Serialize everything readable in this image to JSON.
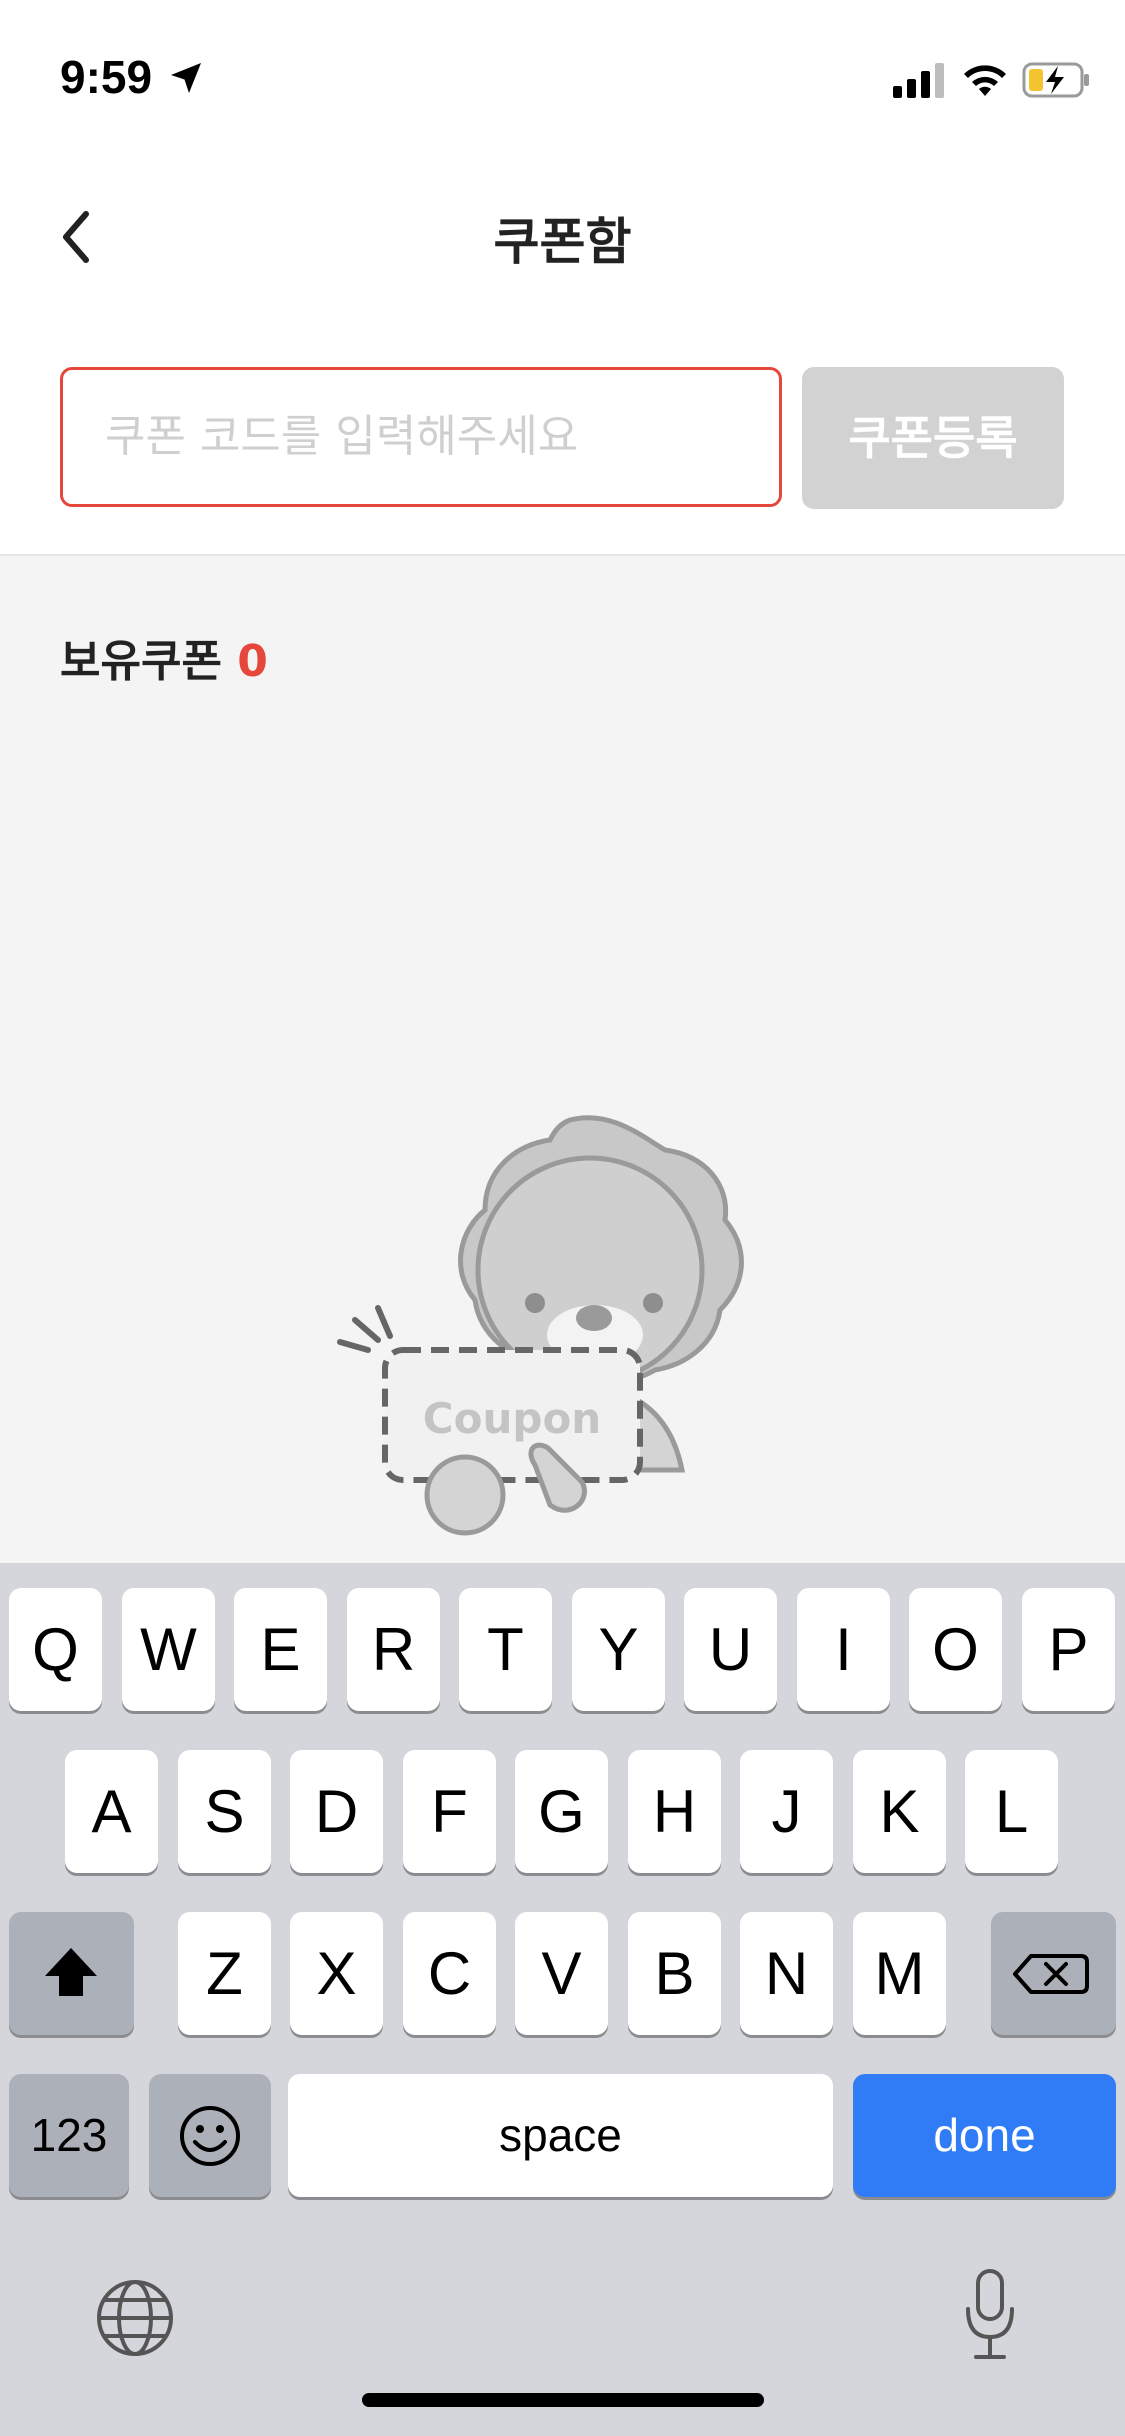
{
  "status_bar": {
    "time": "9:59"
  },
  "header": {
    "title": "쿠폰함"
  },
  "coupon_form": {
    "placeholder": "쿠폰 코드를 입력해주세요",
    "register_label": "쿠폰등록"
  },
  "owned": {
    "label": "보유쿠폰",
    "count": "0"
  },
  "illustration": {
    "coupon_text": "Coupon"
  },
  "keyboard": {
    "row1": [
      "Q",
      "W",
      "E",
      "R",
      "T",
      "Y",
      "U",
      "I",
      "O",
      "P"
    ],
    "row2": [
      "A",
      "S",
      "D",
      "F",
      "G",
      "H",
      "J",
      "K",
      "L"
    ],
    "row3": [
      "Z",
      "X",
      "C",
      "V",
      "B",
      "N",
      "M"
    ],
    "numbers_label": "123",
    "space_label": "space",
    "done_label": "done"
  },
  "colors": {
    "accent": "#e5473b",
    "disabled_button": "#d2d2d2",
    "done_key": "#2f7cf6",
    "keyboard_bg": "#d4d6db"
  }
}
